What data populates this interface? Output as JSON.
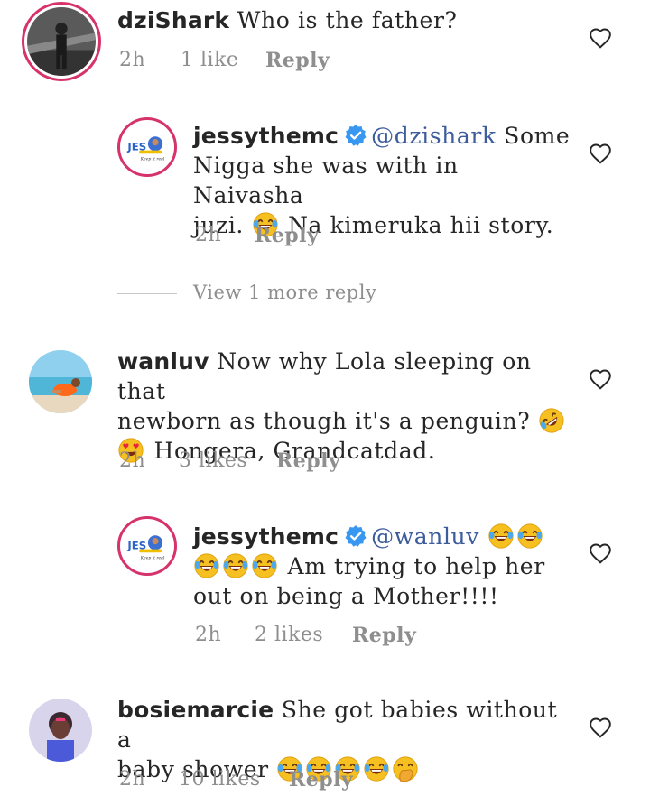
{
  "comments": [
    {
      "username": "dziShark",
      "text": "Who is the father?",
      "time": "2h",
      "likes": "1 like",
      "reply_label": "Reply"
    },
    {
      "username": "jessythemc",
      "mention": "@dzishark",
      "text1": "Some",
      "text2": "Nigga she was with in Naivasha",
      "text3a": "juzi.",
      "text3b": "Na kimeruka hii story.",
      "time": "2h",
      "reply_label": "Reply"
    },
    {
      "username": "wanluv",
      "text1": "Now why Lola sleeping on that",
      "text2": "newborn as though it's a penguin?",
      "text3": "Hongera, Grandcatdad.",
      "time": "2h",
      "likes": "3 likes",
      "reply_label": "Reply"
    },
    {
      "username": "jessythemc",
      "mention": "@wanluv",
      "text2": "Am trying to help her",
      "text3": "out on being a Mother!!!!",
      "time": "2h",
      "likes": "2 likes",
      "reply_label": "Reply"
    },
    {
      "username": "bosiemarcie",
      "text1": "She got babies without a",
      "text2": "baby shower",
      "time": "2h",
      "likes": "10 likes",
      "reply_label": "Reply"
    }
  ],
  "view_more": "View 1 more reply",
  "icons": {
    "heart": "heart-outline-icon",
    "verified": "verified-badge-icon",
    "laugh": "tears-of-joy-emoji",
    "rofl": "rolling-laughing-emoji",
    "hearteyes": "heart-eyes-emoji",
    "hand": "hand-over-mouth-emoji"
  },
  "colors": {
    "story_ring": "#d6336c",
    "verified": "#3897f0",
    "mention": "#3c5c9c",
    "meta": "#8e8e8e"
  }
}
